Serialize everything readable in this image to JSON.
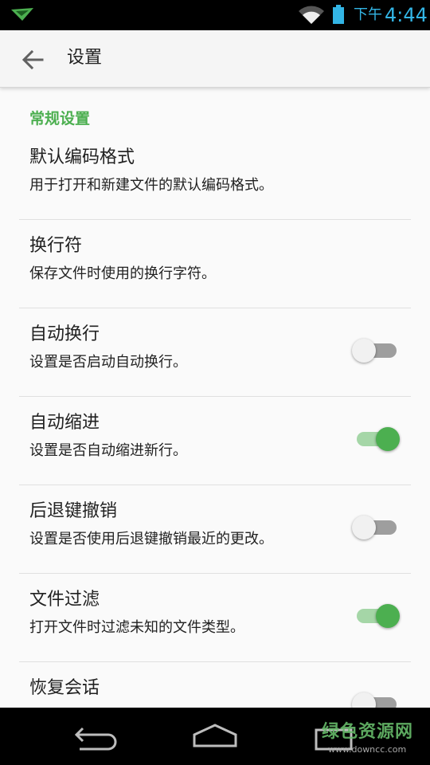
{
  "status_bar": {
    "ampm": "下午",
    "time": "4:44",
    "colors": {
      "accent": "#33b5e5",
      "background": "#000000"
    },
    "icons": [
      "notification-icon",
      "wifi-icon",
      "battery-icon"
    ]
  },
  "app_bar": {
    "title": "设置",
    "back_icon": "arrow-back-icon"
  },
  "section": {
    "header": "常规设置",
    "color": "#4caf50"
  },
  "preferences": [
    {
      "title": "默认编码格式",
      "summary": "用于打开和新建文件的默认编码格式。"
    },
    {
      "title": "换行符",
      "summary": "保存文件时使用的换行字符。"
    },
    {
      "title": "自动换行",
      "summary": "设置是否启动自动换行。",
      "switch": "off"
    },
    {
      "title": "自动缩进",
      "summary": "设置是否自动缩进新行。",
      "switch": "on"
    },
    {
      "title": "后退键撤销",
      "summary": "设置是否使用后退键撤销最近的更改。",
      "switch": "off"
    },
    {
      "title": "文件过滤",
      "summary": "打开文件时过滤未知的文件类型。",
      "switch": "on"
    },
    {
      "title": "恢复会话",
      "switch": "off"
    }
  ],
  "nav_bar": {
    "icons": [
      "nav-back-icon",
      "nav-home-icon",
      "nav-recents-icon"
    ]
  },
  "watermark": {
    "title": "绿色资源网",
    "url": "www.downcc.com"
  }
}
